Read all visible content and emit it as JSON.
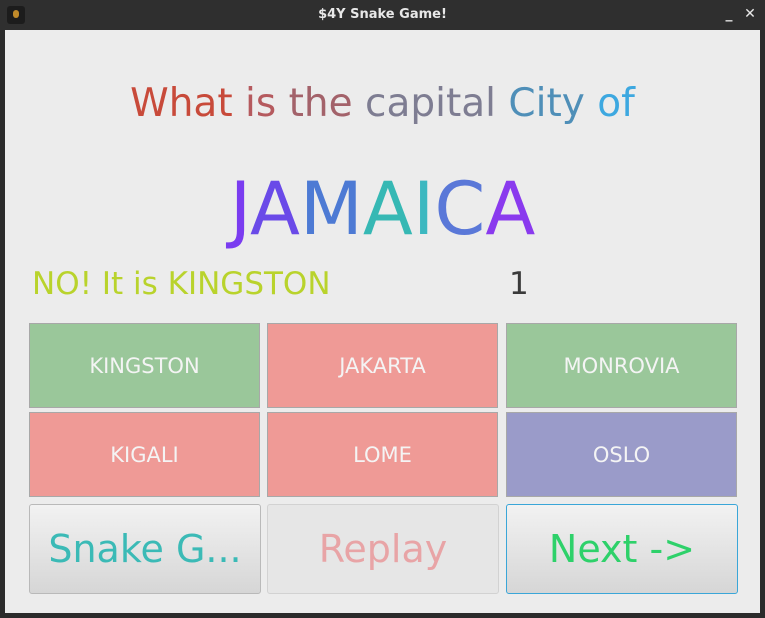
{
  "window": {
    "title": "$4Y Snake Game!",
    "minimize_glyph": "_",
    "close_glyph": "✕"
  },
  "question": {
    "words": [
      {
        "text": "What",
        "color": "#c84a3a"
      },
      {
        "text": "is",
        "color": "#b55a5e"
      },
      {
        "text": "the",
        "color": "#a3626a"
      },
      {
        "text": "capital",
        "color": "#7e7d92"
      },
      {
        "text": "City",
        "color": "#4f8fb8"
      },
      {
        "text": "of",
        "color": "#3da8e0"
      }
    ],
    "country_letters": [
      {
        "text": "J",
        "color": "#7a3cf0"
      },
      {
        "text": "A",
        "color": "#6a4ae8"
      },
      {
        "text": "M",
        "color": "#4d7ad4"
      },
      {
        "text": "A",
        "color": "#36b8b4"
      },
      {
        "text": "I",
        "color": "#3cb8c0"
      },
      {
        "text": "C",
        "color": "#5a78d8"
      },
      {
        "text": "A",
        "color": "#8a3aee"
      }
    ]
  },
  "feedback": "NO! It is KINGSTON",
  "score": "1",
  "answers": [
    {
      "label": "KINGSTON",
      "color": "#9ac79a"
    },
    {
      "label": "JAKARTA",
      "color": "#ef9a96"
    },
    {
      "label": "MONROVIA",
      "color": "#9ac79a"
    },
    {
      "label": "KIGALI",
      "color": "#ef9a96"
    },
    {
      "label": "LOME",
      "color": "#ef9a96"
    },
    {
      "label": "OSLO",
      "color": "#9a9bc9"
    }
  ],
  "controls": {
    "snake_label": "Snake G...",
    "snake_color": "#3bbab6",
    "replay_label": "Replay",
    "replay_color": "#e8a4a6",
    "next_label": "Next ->",
    "next_color": "#2ed16a",
    "next_border": "#3aa6d8"
  }
}
